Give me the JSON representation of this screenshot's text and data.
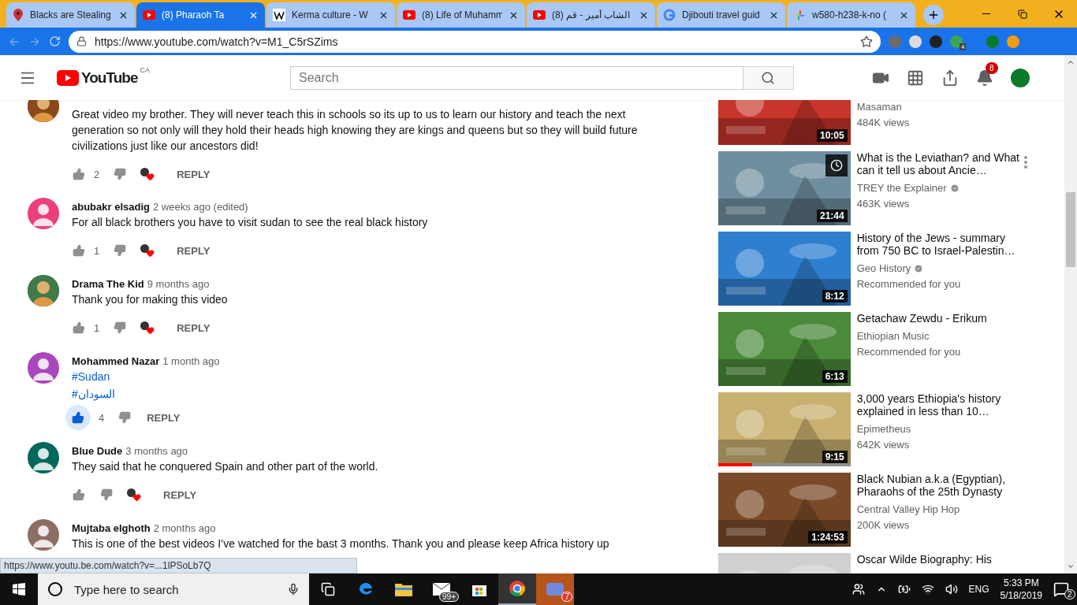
{
  "browser": {
    "tabs": [
      {
        "title": "Blacks are Stealing",
        "selected": false
      },
      {
        "title": "(8) Pharaoh Ta",
        "selected": true
      },
      {
        "title": "Kerma culture - W",
        "selected": false
      },
      {
        "title": "(8) Life of Muhamm",
        "selected": false
      },
      {
        "title": "(8) الشاب أمير - قم",
        "selected": false
      },
      {
        "title": "Djibouti travel guid",
        "selected": false
      },
      {
        "title": "w580-h238-k-no (",
        "selected": false
      }
    ],
    "url": "https://www.youtube.com/watch?v=M1_C5rSZims",
    "extension_badge": "4"
  },
  "youtube": {
    "logo": "YouTube",
    "region": "CA",
    "search": {
      "placeholder": "Search"
    },
    "notifications": "8"
  },
  "comments": [
    {
      "color": "#8a4a1c",
      "text": [
        {
          "kind": "text",
          "value": "Great video my brother. They will never teach this in schools so its up to us to learn our history and teach the next generation so not only will they hold their heads high knowing they are kings and queens but so they will build future civilizations just like our ancestors did!"
        }
      ],
      "likes": "2",
      "liked": false,
      "hearted": true,
      "reply": "REPLY"
    },
    {
      "author": "abubakr elsadig",
      "time": "2 weeks ago (edited)",
      "kind": "default",
      "color": "#ec407a",
      "text": [
        {
          "kind": "text",
          "value": "For all black brothers you have to visit sudan to see the real black history"
        }
      ],
      "likes": "1",
      "liked": false,
      "hearted": true,
      "reply": "REPLY"
    },
    {
      "author": "Drama The Kid",
      "time": "9 months ago",
      "color": "#3f7a4a",
      "text": [
        {
          "kind": "text",
          "value": "Thank you for making this video"
        }
      ],
      "likes": "1",
      "liked": false,
      "hearted": true,
      "reply": "REPLY"
    },
    {
      "author": "Mohammed Nazar",
      "time": "1 month ago",
      "kind": "default",
      "color": "#ab47bc",
      "text": [
        {
          "kind": "hashtag",
          "value": "#Sudan"
        },
        {
          "kind": "hashtag",
          "value": "#السودان"
        }
      ],
      "likes": "4",
      "liked": true,
      "hearted": false,
      "reply": "REPLY"
    },
    {
      "author": "Blue Dude",
      "time": "3 months ago",
      "kind": "default",
      "color": "#00695c",
      "text": [
        {
          "kind": "text",
          "value": "They said that he conquered Spain and other part of the world."
        }
      ],
      "liked": false,
      "hearted": true,
      "reply": "REPLY"
    },
    {
      "author": "Mujtaba elghoth",
      "time": "2 months ago",
      "kind": "default",
      "color": "#8d6e63",
      "text": [
        {
          "kind": "text",
          "value": "This is one of the best videos I’ve watched for the bast 3 months. Thank you and please keep Africa history up"
        }
      ]
    }
  ],
  "sidebar": [
    {
      "channel": "Masaman",
      "views": "484K views",
      "duration": "10:05"
    },
    {
      "title": "What is the Leviathan? and What can it tell us about Ancie…",
      "channel": "TREY the Explainer",
      "verified": true,
      "views": "463K views",
      "duration": "21:44",
      "menu": true,
      "watch_later": true
    },
    {
      "title": "History of the Jews - summary from 750 BC to Israel-Palestin…",
      "channel": "Geo History",
      "verified": true,
      "views": "Recommended for you",
      "duration": "8:12"
    },
    {
      "title": "Getachaw Zewdu - Erikum",
      "channel": "Ethiopian Music",
      "views": "Recommended for you",
      "duration": "6:13"
    },
    {
      "title": "3,000 years Ethiopia's history explained in less than 10…",
      "channel": "Epimetheus",
      "views": "642K views",
      "duration": "9:15",
      "level": 0.26
    },
    {
      "title": "Black Nubian a.k.a (Egyptian), Pharaohs of the 25th Dynasty",
      "channel": "Central Valley Hip Hop",
      "views": "200K views",
      "duration": "1:24:53"
    },
    {
      "title": "Oscar Wilde Biography: His"
    }
  ],
  "status_url": "https://www.youtu.be.com/watch?v=...1lPSoLb7Q",
  "taskbar": {
    "search": {
      "placeholder": "Type here to search"
    },
    "mail_badge": "99+",
    "app_badge": "7",
    "language": "ENG",
    "time": "5:33 PM",
    "date": "5/18/2019",
    "notifications": "2"
  }
}
